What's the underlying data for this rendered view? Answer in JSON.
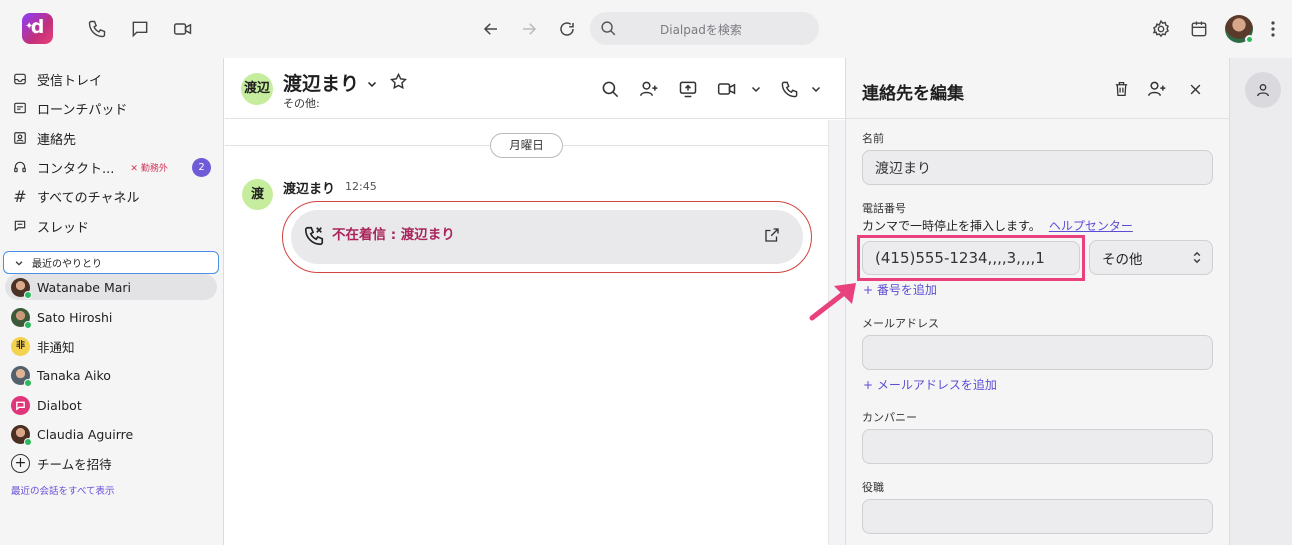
{
  "app": {
    "logo_letter": "d",
    "search_placeholder": "Dialpadを検索"
  },
  "sidebar": {
    "nav": [
      {
        "label": "受信トレイ",
        "icon": "inbox-icon"
      },
      {
        "label": "ローンチパッド",
        "icon": "launchpad-icon"
      },
      {
        "label": "連絡先",
        "icon": "contacts-icon"
      },
      {
        "label": "コンタクト...",
        "icon": "headset-icon",
        "status": "勤務外",
        "badge": "2"
      },
      {
        "label": "すべてのチャネル",
        "icon": "hash-icon"
      },
      {
        "label": "スレッド",
        "icon": "threads-icon"
      }
    ],
    "recent_header": "最近のやりとり",
    "recent": [
      {
        "name": "Watanabe Mari",
        "active": true
      },
      {
        "name": "Sato Hiroshi"
      },
      {
        "name": "非通知",
        "initial": "非"
      },
      {
        "name": "Tanaka Aiko"
      },
      {
        "name": "Dialbot"
      },
      {
        "name": "Claudia Aguirre"
      }
    ],
    "invite_label": "チームを招待",
    "show_all": "最近の会話をすべて表示"
  },
  "conversation": {
    "avatar_text": "渡辺",
    "name": "渡辺まり",
    "subtitle": "その他:",
    "day_label": "月曜日",
    "message": {
      "avatar_text": "渡",
      "sender": "渡辺まり",
      "time": "12:45",
      "call_label": "不在着信 : 渡辺まり"
    }
  },
  "edit_panel": {
    "title": "連絡先を編集",
    "name_label": "名前",
    "name_value": "渡辺まり",
    "phone_label": "電話番号",
    "phone_helper": "カンマで一時停止を挿入します。",
    "help_link": "ヘルプセンター",
    "phone_value": "(415)555-1234,,,,3,,,,1",
    "phone_type": "その他",
    "add_phone": "+ 番号を追加",
    "email_label": "メールアドレス",
    "email_value": "",
    "add_email": "+ メールアドレスを追加",
    "company_label": "カンパニー",
    "company_value": "",
    "role_label": "役職",
    "role_value": ""
  },
  "colors": {
    "accent": "#5b4dd6",
    "missed_call": "#a8245a",
    "highlight": "#e8417d",
    "online": "#2cb85c"
  }
}
